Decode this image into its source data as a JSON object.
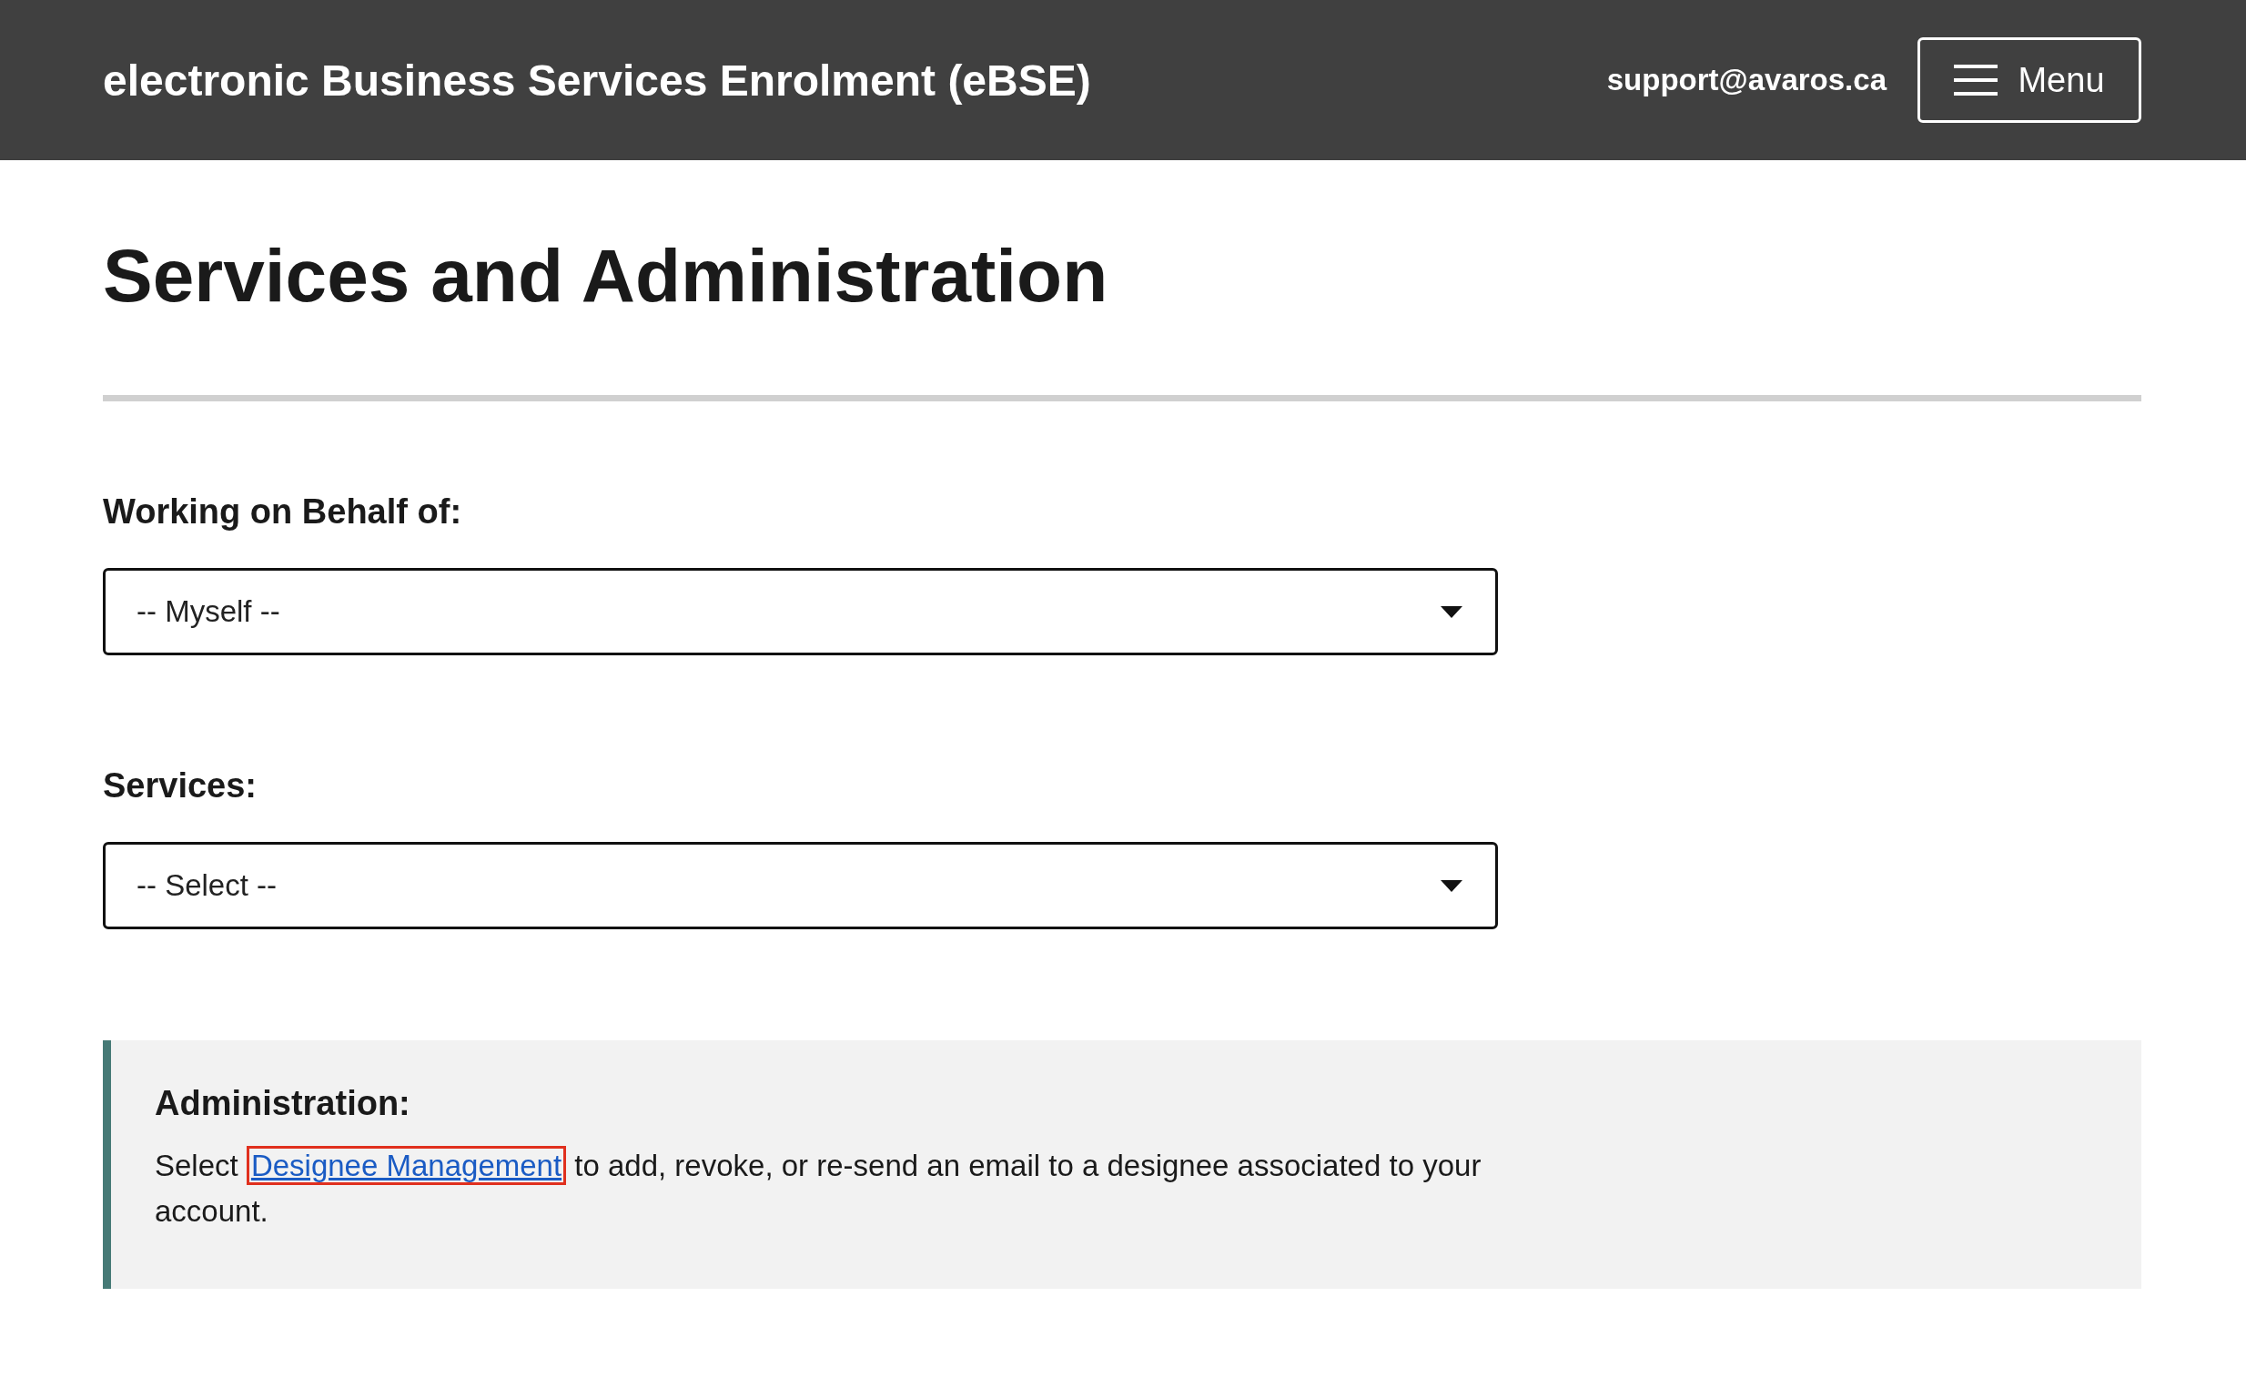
{
  "header": {
    "title": "electronic Business Services Enrolment (eBSE)",
    "email": "support@avaros.ca",
    "menu_button": "Menu"
  },
  "page_title": "Services and Administration",
  "fields": [
    {
      "label": "Working on Behalf of:",
      "value": "-- Myself --"
    },
    {
      "label": "Services:",
      "value": "-- Select --"
    }
  ],
  "administration": {
    "heading": "Administration:",
    "text_before": "Select",
    "link": "Designee Management",
    "link_highlighted": true,
    "text_after": "to add, revoke, or re-send an email to a designee associated to your account."
  }
}
